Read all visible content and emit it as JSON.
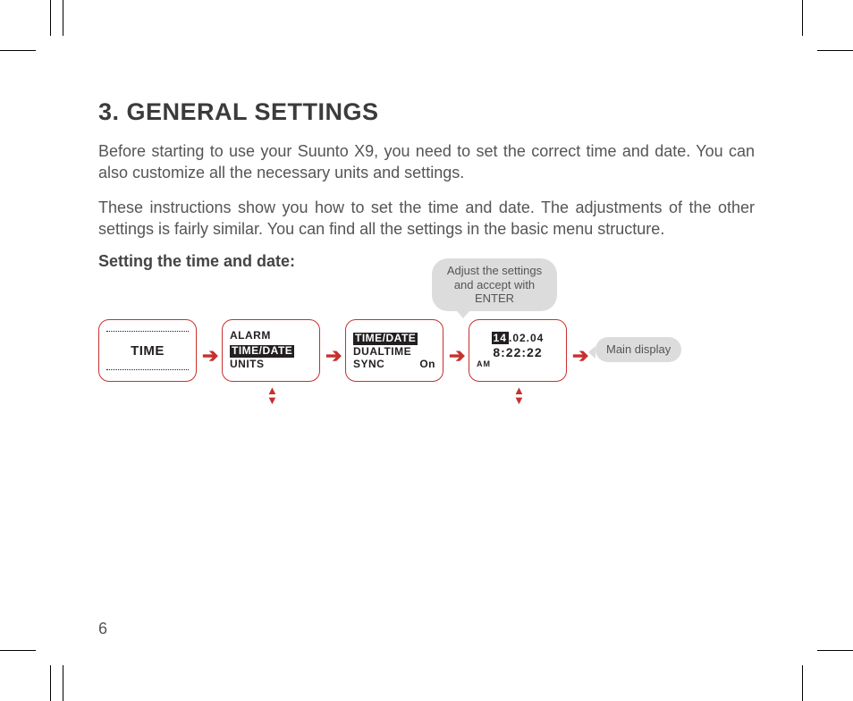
{
  "heading": "3. GENERAL SETTINGS",
  "para1": "Before starting to use your Suunto X9, you need to set the correct time and date. You can also customize all the necessary units and settings.",
  "para2": "These instructions show you how to set the time and date. The adjustments of the other settings is fairly similar. You can find all the settings in the basic menu structure.",
  "subhead": "Setting the time and date:",
  "bubble_adjust": "Adjust the settings and accept with ENTER",
  "bubble_main": "Main display",
  "screen1": {
    "label": "TIME"
  },
  "screen2": {
    "l1": "ALARM",
    "l2": "TIME/DATE",
    "l3": "UNITS"
  },
  "screen3": {
    "l1": "TIME/DATE",
    "l2": "DUALTIME",
    "l3a": "SYNC",
    "l3b": "On"
  },
  "screen4": {
    "day": "14",
    "date_rest": ".02.04",
    "time": "8:22:22",
    "ampm": "AM"
  },
  "page_number": "6"
}
